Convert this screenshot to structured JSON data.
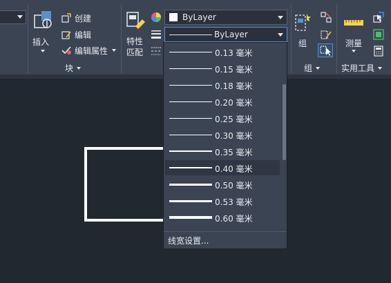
{
  "ribbon": {
    "insert_label": "插入",
    "block_tools": [
      {
        "label": "创建",
        "icon": "block-create-icon"
      },
      {
        "label": "编辑",
        "icon": "block-edit-icon"
      },
      {
        "label": "编辑属性",
        "icon": "edit-attributes-icon"
      }
    ],
    "block_panel_title": "块",
    "match_properties_label": "特性匹配",
    "match_properties_line1": "特性",
    "match_properties_line2": "匹配",
    "group_label": "组",
    "group_panel_title": "组",
    "measure_label": "测量",
    "utilities_panel_title": "实用工具"
  },
  "properties": {
    "color_value": "ByLayer",
    "lineweight_value": "ByLayer",
    "color_swatch": "#ffffff"
  },
  "lineweight_dropdown": {
    "items": [
      {
        "label": "0.13 毫米",
        "weight_mm": 0.13
      },
      {
        "label": "0.15 毫米",
        "weight_mm": 0.15
      },
      {
        "label": "0.18 毫米",
        "weight_mm": 0.18
      },
      {
        "label": "0.20 毫米",
        "weight_mm": 0.2
      },
      {
        "label": "0.25 毫米",
        "weight_mm": 0.25
      },
      {
        "label": "0.30 毫米",
        "weight_mm": 0.3
      },
      {
        "label": "0.35 毫米",
        "weight_mm": 0.35
      },
      {
        "label": "0.40 毫米",
        "weight_mm": 0.4,
        "selected": true
      },
      {
        "label": "0.50 毫米",
        "weight_mm": 0.5
      },
      {
        "label": "0.53 毫米",
        "weight_mm": 0.53
      },
      {
        "label": "0.60 毫米",
        "weight_mm": 0.6
      }
    ],
    "settings_label": "线宽设置..."
  },
  "colors": {
    "ribbon_bg": "#3b4453",
    "canvas_bg": "#212830",
    "accent": "#5e8fcb",
    "text": "#e6e9ee"
  }
}
